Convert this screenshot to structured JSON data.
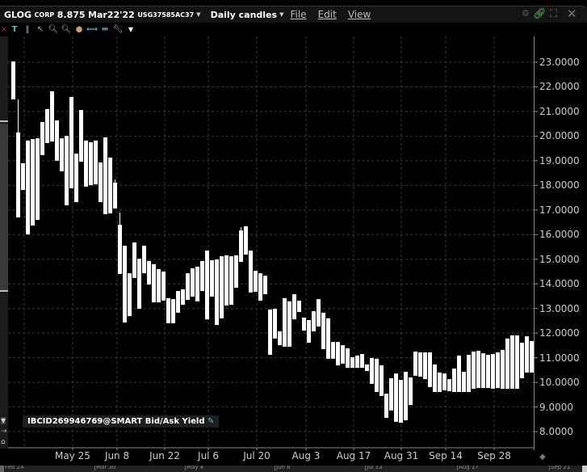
{
  "header": {
    "symbol": "GLOG",
    "corp": "CORP",
    "coupon": "8.875",
    "maturity": "Mar22'22",
    "isin": "USG37585AC37",
    "chart_type": "Daily candles",
    "menus": [
      "File",
      "Edit",
      "View"
    ]
  },
  "legend": {
    "text": "IBCID269946769@SMART Bid/Ask Yield"
  },
  "y_axis": {
    "labels": [
      "23.0000",
      "22.0000",
      "21.0000",
      "20.0000",
      "19.0000",
      "18.0000",
      "17.0000",
      "16.0000",
      "15.0000",
      "14.0000",
      "13.0000",
      "12.0000",
      "11.0000",
      "10.0000",
      "9.0000",
      "8.0000"
    ]
  },
  "x_axis": {
    "labels": [
      "May 25",
      "Jun 8",
      "Jun 22",
      "Jul 6",
      "Jul 20",
      "Aug 3",
      "Aug 17",
      "Aug 31",
      "Sep 14",
      "Sep 28"
    ]
  },
  "navigator": {
    "labels": [
      "Feb 24",
      "Mar 30",
      "May 4",
      "Jun 8",
      "Jul 13",
      "Aug 17",
      "Sep 21"
    ]
  },
  "chart_data": {
    "type": "candlestick",
    "ylim": [
      7.4,
      24.0
    ],
    "candles": [
      [
        23.03,
        21.49
      ],
      [
        20.15,
        16.7
      ],
      [
        18.9,
        17.81
      ],
      [
        19.82,
        16.01
      ],
      [
        19.88,
        16.37
      ],
      [
        19.91,
        16.6
      ],
      [
        20.57,
        19.23
      ],
      [
        21.1,
        19.72
      ],
      [
        21.82,
        19.78
      ],
      [
        20.64,
        19.0
      ],
      [
        19.91,
        18.57
      ],
      [
        20.01,
        17.19
      ],
      [
        21.59,
        17.88
      ],
      [
        19.29,
        17.32
      ],
      [
        21.06,
        18.96
      ],
      [
        19.82,
        17.95
      ],
      [
        19.75,
        18.01
      ],
      [
        19.82,
        18.04
      ],
      [
        18.93,
        17.32
      ],
      [
        19.95,
        16.83
      ],
      [
        19.13,
        16.86
      ],
      [
        18.11,
        17.06
      ],
      [
        16.4,
        14.4
      ],
      [
        15.55,
        12.43
      ],
      [
        14.43,
        12.69
      ],
      [
        15.68,
        14.24
      ],
      [
        15.02,
        12.99
      ],
      [
        15.55,
        14.43
      ],
      [
        14.93,
        13.97
      ],
      [
        14.8,
        13.25
      ],
      [
        14.6,
        13.25
      ],
      [
        14.5,
        13.32
      ],
      [
        13.42,
        12.4
      ],
      [
        13.38,
        12.4
      ],
      [
        13.71,
        12.83
      ],
      [
        13.78,
        13.15
      ],
      [
        14.43,
        13.35
      ],
      [
        14.63,
        13.48
      ],
      [
        14.7,
        13.29
      ],
      [
        14.93,
        13.71
      ],
      [
        15.35,
        12.56
      ],
      [
        14.96,
        13.48
      ],
      [
        14.99,
        12.33
      ],
      [
        15.12,
        12.6
      ],
      [
        15.16,
        13.12
      ],
      [
        15.12,
        13.15
      ],
      [
        15.16,
        13.84
      ],
      [
        16.17,
        14.89
      ],
      [
        16.34,
        15.19
      ],
      [
        15.35,
        13.65
      ],
      [
        14.53,
        13.68
      ],
      [
        14.43,
        13.32
      ],
      [
        14.33,
        13.58
      ],
      [
        12.96,
        11.12
      ],
      [
        12.99,
        11.78
      ],
      [
        12.07,
        11.51
      ],
      [
        13.42,
        11.45
      ],
      [
        13.29,
        11.45
      ],
      [
        13.58,
        12.56
      ],
      [
        13.32,
        12.86
      ],
      [
        12.63,
        12.1
      ],
      [
        12.53,
        11.61
      ],
      [
        12.89,
        12.07
      ],
      [
        13.38,
        12.27
      ],
      [
        12.83,
        11.35
      ],
      [
        12.6,
        10.96
      ],
      [
        11.64,
        10.96
      ],
      [
        11.64,
        10.69
      ],
      [
        11.51,
        10.76
      ],
      [
        11.38,
        10.59
      ],
      [
        11.02,
        10.59
      ],
      [
        11.09,
        10.59
      ],
      [
        11.15,
        10.59
      ],
      [
        10.73,
        10.46
      ],
      [
        10.99,
        9.94
      ],
      [
        10.96,
        9.61
      ],
      [
        10.69,
        9.45
      ],
      [
        9.54,
        8.56
      ],
      [
        10.17,
        8.86
      ],
      [
        10.36,
        8.4
      ],
      [
        10.1,
        8.36
      ],
      [
        10.43,
        8.46
      ],
      [
        10.2,
        9.08
      ],
      [
        11.25,
        10.27
      ],
      [
        11.22,
        10.23
      ],
      [
        11.22,
        10.13
      ],
      [
        11.22,
        9.81
      ],
      [
        10.73,
        9.61
      ],
      [
        10.4,
        9.61
      ],
      [
        10.36,
        9.68
      ],
      [
        10.13,
        9.64
      ],
      [
        10.56,
        9.61
      ],
      [
        11.09,
        9.61
      ],
      [
        10.43,
        9.61
      ],
      [
        11.12,
        9.61
      ],
      [
        11.25,
        9.74
      ],
      [
        11.28,
        9.77
      ],
      [
        11.18,
        9.77
      ],
      [
        11.12,
        9.77
      ],
      [
        11.15,
        9.74
      ],
      [
        11.22,
        9.77
      ],
      [
        11.32,
        9.74
      ],
      [
        11.78,
        9.74
      ],
      [
        11.91,
        9.74
      ],
      [
        11.91,
        9.74
      ],
      [
        11.61,
        10.17
      ],
      [
        11.87,
        10.4
      ],
      [
        11.68,
        10.4
      ]
    ],
    "wicks": {
      "1": 21.49,
      "21": 18.24,
      "22": 16.9,
      "47": 16.3
    }
  }
}
